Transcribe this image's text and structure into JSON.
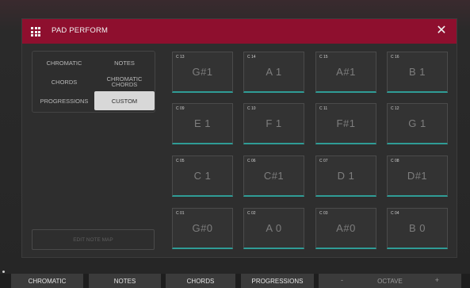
{
  "modal": {
    "title": "PAD PERFORM",
    "close_glyph": "✕",
    "icons": {
      "menu": "grid-icon",
      "close": "close-icon"
    }
  },
  "modes": [
    {
      "label": "CHROMATIC",
      "active": false
    },
    {
      "label": "NOTES",
      "active": false
    },
    {
      "label": "CHORDS",
      "active": false
    },
    {
      "label": "CHROMATIC CHORDS",
      "active": false
    },
    {
      "label": "PROGRESSIONS",
      "active": false
    },
    {
      "label": "CUSTOM",
      "active": true
    }
  ],
  "edit_note_map_label": "EDIT NOTE MAP",
  "pads": [
    {
      "id": "C 13",
      "note": "G#1"
    },
    {
      "id": "C 14",
      "note": "A 1"
    },
    {
      "id": "C 15",
      "note": "A#1"
    },
    {
      "id": "C 16",
      "note": "B 1"
    },
    {
      "id": "C 09",
      "note": "E 1"
    },
    {
      "id": "C 10",
      "note": "F 1"
    },
    {
      "id": "C 11",
      "note": "F#1"
    },
    {
      "id": "C 12",
      "note": "G 1"
    },
    {
      "id": "C 05",
      "note": "C 1"
    },
    {
      "id": "C 06",
      "note": "C#1"
    },
    {
      "id": "C 07",
      "note": "D 1"
    },
    {
      "id": "C 08",
      "note": "D#1"
    },
    {
      "id": "C 01",
      "note": "G#0"
    },
    {
      "id": "C 02",
      "note": "A 0"
    },
    {
      "id": "C 03",
      "note": "A#0"
    },
    {
      "id": "C 04",
      "note": "B 0"
    }
  ],
  "bottom_bar": {
    "buttons": [
      "CHROMATIC",
      "NOTES",
      "CHORDS",
      "PROGRESSIONS"
    ],
    "octave": {
      "label": "OCTAVE",
      "minus": "-",
      "plus": "+"
    }
  },
  "colors": {
    "header": "#8e0f2e",
    "pad_accent": "#2f9c96",
    "active_mode": "#d8d8d8"
  }
}
